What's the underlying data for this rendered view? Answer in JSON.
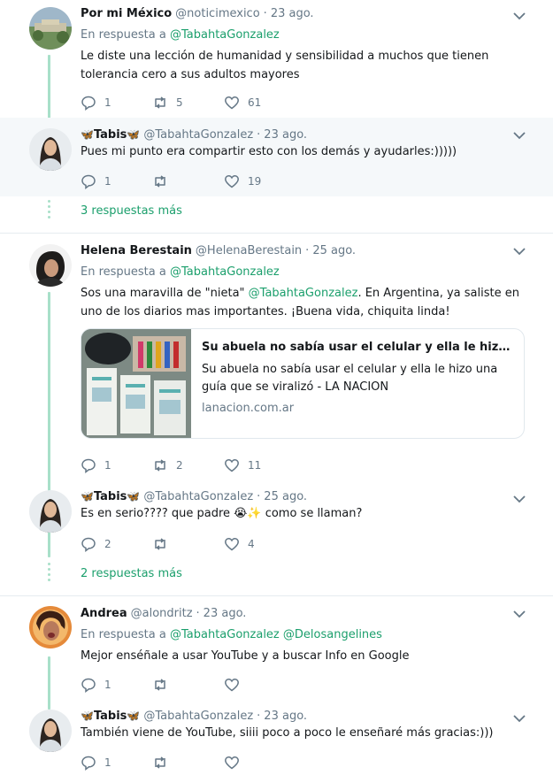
{
  "colors": {
    "accent": "#1b9f6c",
    "thread_line": "#a8e0c9",
    "muted": "#657786",
    "highlight_bg": "#f5f8fa"
  },
  "tweets": [
    {
      "name": "Por mi México",
      "handle": "@noticimexico",
      "time": "23 ago.",
      "reply_prefix": "En respuesta a",
      "reply_to": "@TabahtaGonzalez",
      "text": "Le diste una lección de humanidad y sensibilidad a muchos que tienen tolerancia cero a sus adultos mayores",
      "replies": "1",
      "retweets": "5",
      "likes": "61"
    },
    {
      "name_emoji_left": "🦋",
      "name": "Tabis",
      "name_emoji_right": "🦋",
      "handle": "@TabahtaGonzalez",
      "time": "23 ago.",
      "text": "Pues mi punto era compartir esto con los demás y ayudarles:)))))",
      "replies": "1",
      "retweets": "",
      "likes": "19"
    },
    {
      "name": "Helena Berestain",
      "handle": "@HelenaBerestain",
      "time": "25 ago.",
      "reply_prefix": "En respuesta a",
      "reply_to": "@TabahtaGonzalez",
      "text_a": "Sos una maravilla de \"nieta\" ",
      "text_mention": "@TabahtaGonzalez",
      "text_b": ". En Argentina, ya saliste en uno de los diarios mas importantes. ¡Buena vida, chiquita linda!",
      "replies": "1",
      "retweets": "2",
      "likes": "11"
    },
    {
      "name_emoji_left": "🦋",
      "name": "Tabis",
      "name_emoji_right": "🦋",
      "handle": "@TabahtaGonzalez",
      "time": "25 ago.",
      "text": "Es en serio???? que padre 😭✨ como se llaman?",
      "replies": "2",
      "retweets": "",
      "likes": "4"
    },
    {
      "name": "Andrea",
      "handle": "@alondritz",
      "time": "23 ago.",
      "reply_prefix": "En respuesta a",
      "reply_to": "@TabahtaGonzalez",
      "reply_to_2": "@Delosangelines",
      "text": "Mejor enséñale a usar YouTube y a buscar Info en Google",
      "replies": "1",
      "retweets": "",
      "likes": ""
    },
    {
      "name_emoji_left": "🦋",
      "name": "Tabis",
      "name_emoji_right": "🦋",
      "handle": "@TabahtaGonzalez",
      "time": "23 ago.",
      "text": "También viene de YouTube, siiii poco a poco le enseñaré más gracias:)))",
      "replies": "1",
      "retweets": "",
      "likes": ""
    }
  ],
  "more_1": "3 respuestas más",
  "more_2": "2 respuestas más",
  "card": {
    "title": "Su abuela no sabía usar el celular y ella le hizo un...",
    "description": "Su abuela no sabía usar el celular y ella le hizo una guía que se viralizó - LA NACION",
    "domain": "lanacion.com.ar"
  },
  "icons": {
    "reply": "reply-icon",
    "retweet": "retweet-icon",
    "like": "heart-icon",
    "caret": "chevron-down-icon"
  }
}
